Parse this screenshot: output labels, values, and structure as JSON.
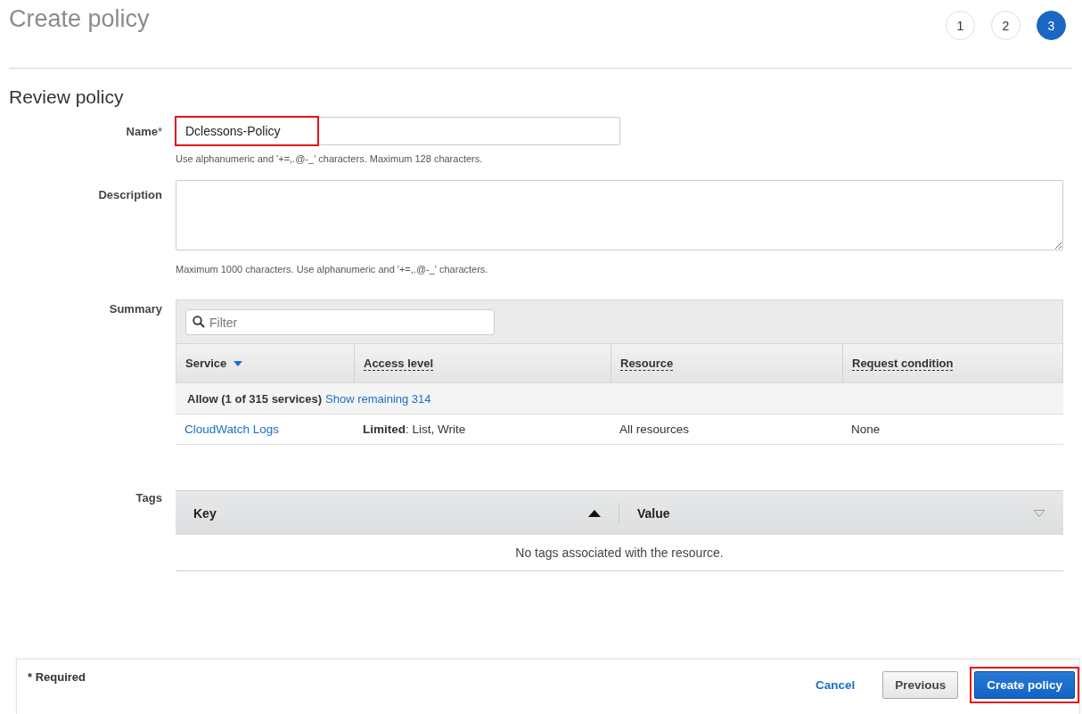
{
  "page_title": "Create policy",
  "steps": [
    {
      "label": "1",
      "selected": false
    },
    {
      "label": "2",
      "selected": false
    },
    {
      "label": "3",
      "selected": true
    }
  ],
  "section_title": "Review policy",
  "name_field": {
    "label": "Name",
    "required_mark": "*",
    "value": "Dclessons-Policy",
    "highlighted": true,
    "hint": "Use alphanumeric and '+=,.@-_' characters. Maximum 128 characters."
  },
  "description_field": {
    "label": "Description",
    "hint": "Maximum 1000 characters. Use alphanumeric and '+=,.@-_' characters."
  },
  "summary": {
    "label": "Summary",
    "filter": {
      "placeholder": "Filter"
    },
    "columns": [
      {
        "label": "Service",
        "sorted": true
      },
      {
        "label": "Access level",
        "sorted": false
      },
      {
        "label": "Resource",
        "sorted": false
      },
      {
        "label": "Request condition",
        "sorted": false
      }
    ],
    "group": {
      "label": "Allow (1 of 315 services)",
      "link": "Show remaining 314"
    },
    "rows": [
      {
        "service": "CloudWatch Logs",
        "access_level": "**Limited**: List, Write",
        "resource": "All resources",
        "request_condition": "None"
      }
    ]
  },
  "tags": {
    "label": "Tags",
    "columns": [
      {
        "label": "Key",
        "sorted": true
      },
      {
        "label": "Value",
        "sorted": false
      }
    ],
    "empty_text": "No tags associated with the resource."
  },
  "footer": {
    "required_note": "* Required",
    "buttons": [
      {
        "label": "Cancel",
        "kind": "link",
        "highlighted": false
      },
      {
        "label": "Previous",
        "kind": "secondary",
        "highlighted": false
      },
      {
        "label": "Create policy",
        "kind": "primary",
        "highlighted": true
      }
    ]
  }
}
